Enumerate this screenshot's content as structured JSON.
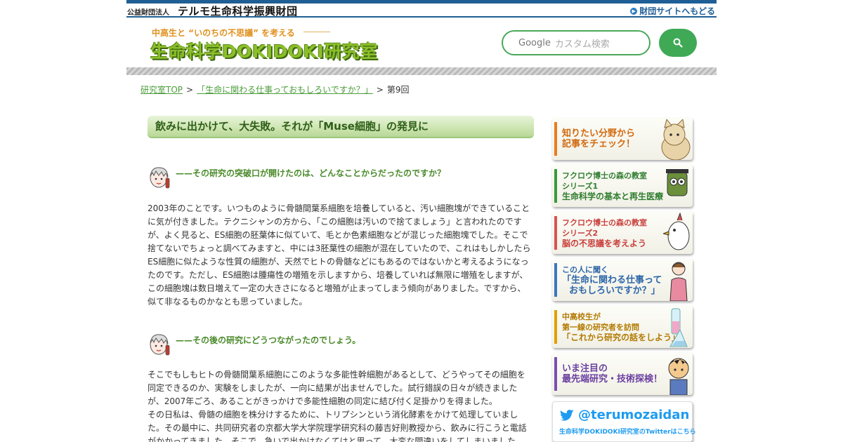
{
  "header": {
    "org_prefix": "公益財団法人",
    "org_name": "テルモ生命科学振興財団",
    "back_link": "財団サイトへもどる",
    "tagline": "中高生と “いのちの不思議” を考える",
    "brand": "生命科学DOKIDOKI研究室"
  },
  "search": {
    "brand": "Google",
    "placeholder": "カスタム検索",
    "button_icon": "search-icon"
  },
  "breadcrumb": {
    "items": [
      "研究室TOP",
      "「生命に関わる仕事っておもしろいですか？」",
      "第9回"
    ],
    "separator": ">"
  },
  "article": {
    "title": "飲みに出かけて、大失敗。それが「Muse細胞」の発見に",
    "q1": "——その研究の突破口が開けたのは、どんなことからだったのですか？",
    "p1": [
      "2003年のことです。いつものように骨髄間葉系細胞を培養していると、汚い細胞塊ができていること",
      "に気が付きました。テクニシャンの方から、「この細胞は汚いので捨てましょう」と言われたのです",
      "が、よく見ると、ES細胞の胚葉体に似ていて、毛とか色素細胞などが混じった細胞塊でした。そこで",
      "捨てないでちょっと調べてみますと、中には3胚葉性の細胞が混在していたので、これはもしかしたら",
      "ES細胞に似たような性質の細胞が、天然でヒトの骨髄などにもあるのではないかと考えるようになっ",
      "たのです。ただし、ES細胞は腫瘍性の増殖を示しますから、培養していれば無限に増殖をしますが、",
      "この細胞塊は数日増えて一定の大きさになると増殖が止まってしまう傾向がありました。ですから、",
      "似て非なるものかなとも思っていました。"
    ],
    "q2": "——その後の研究にどうつながったのでしょう。",
    "p2": [
      "そこでもしもヒトの骨髄間葉系細胞にこのような多能性幹細胞があるとして、どうやってその細胞を",
      "同定できるのか、実験をしましたが、一向に結果が出ませんでした。試行錯誤の日々が続きました",
      "が、2007年ごろ、あることがきっかけで多能性細胞の同定に結び付く足掛かりを得ました。",
      "その日私は、骨髄の細胞を株分けするために、トリプシンという消化酵素をかけて処理していまし",
      "た。その最中に、共同研究者の京都大学大学院理学研究科の藤吉好則教授から、飲みに行こうと電話",
      "がかかってきました。そこで、急いで出かけなくてはと思って、大変な間違いをしてしまいました"
    ]
  },
  "sidebar": {
    "items": [
      {
        "lines": [
          "知りたい分野から",
          "記事をチェック！"
        ],
        "color": "#e87d1e",
        "icon": "cat-icon"
      },
      {
        "lines": [
          "フクロウ博士の森の教室",
          "シリーズ1",
          "生命科学の基本と再生医療"
        ],
        "color": "#3a9a3a",
        "icon": "owl-icon"
      },
      {
        "lines": [
          "フクロウ博士の森の教室",
          "シリーズ2",
          "脳の不思議を考えよう"
        ],
        "color": "#d9534f",
        "icon": "bird-icon"
      },
      {
        "lines": [
          "この人に聞く",
          "「生命に関わる仕事って",
          "おもしろいですか？」"
        ],
        "color": "#3a78c0",
        "icon": "person-icon"
      },
      {
        "lines": [
          "中高校生が",
          "第一線の研究者を訪問",
          "「これから研究の話をしよう」"
        ],
        "color": "#e0a000",
        "icon": "flask-icon"
      },
      {
        "lines": [
          "いま注目の",
          "最先端研究・技術探検！"
        ],
        "color": "#7b4fb0",
        "icon": "boy-icon"
      }
    ],
    "twitter": {
      "handle": "@terumozaidan",
      "sub": "生命科学DOKIDOKI研究室のTwitterはこちら",
      "color": "#1d9bf0"
    }
  }
}
